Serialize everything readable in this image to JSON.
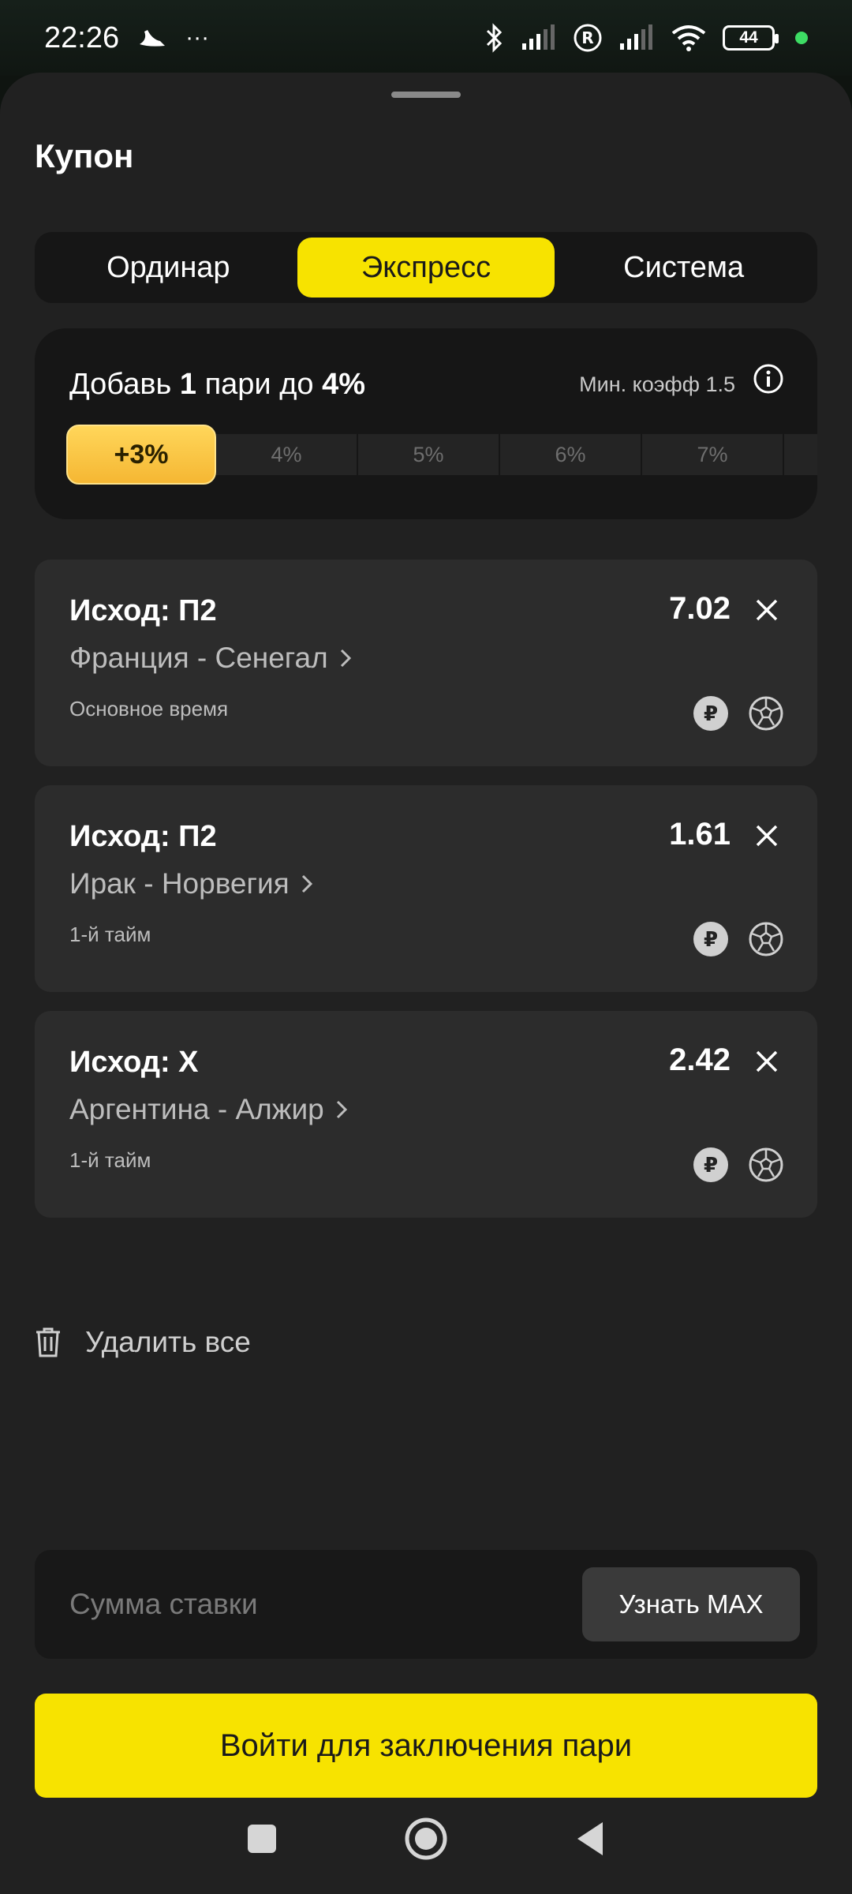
{
  "status_bar": {
    "time": "22:26",
    "more": "···",
    "battery": "44"
  },
  "coupon": {
    "title": "Купон",
    "tabs": [
      "Ординар",
      "Экспресс",
      "Система"
    ],
    "active_tab": "Экспресс"
  },
  "promo": {
    "title_prefix": "Добавь ",
    "title_count": "1",
    "title_middle": " пари до ",
    "title_percent": "4%",
    "min_coef": "Мин. коэфф 1.5",
    "current_bonus": "+3%",
    "levels": [
      "4%",
      "5%",
      "6%",
      "7%"
    ]
  },
  "bets": [
    {
      "outcome": "Исход: П2",
      "match": "Франция - Сенегал",
      "period": "Основное время",
      "odds": "7.02"
    },
    {
      "outcome": "Исход: П2",
      "match": "Ирак - Норвегия",
      "period": "1-й тайм",
      "odds": "1.61"
    },
    {
      "outcome": "Исход: X",
      "match": "Аргентина - Алжир",
      "period": "1-й тайм",
      "odds": "2.42"
    }
  ],
  "actions": {
    "delete_all": "Удалить все",
    "stake_placeholder": "Сумма ставки",
    "max_button": "Узнать MAX",
    "login_button": "Войти для заключения пари"
  },
  "colors": {
    "accent": "#f7e300",
    "sheet_bg": "#212121",
    "card_bg": "#2c2c2c"
  }
}
